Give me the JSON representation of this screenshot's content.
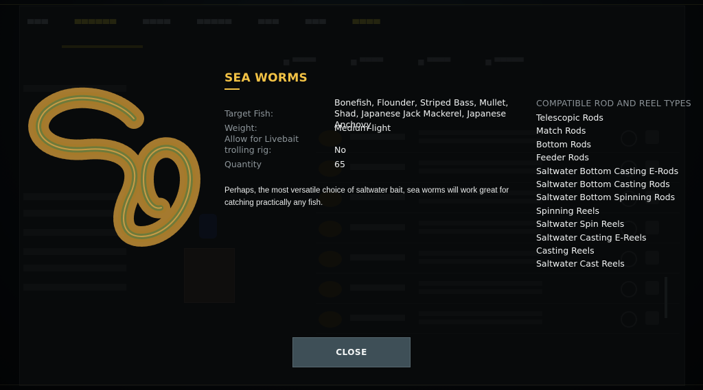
{
  "item": {
    "title": "SEA WORMS",
    "target_fish_label": "Target Fish:",
    "target_fish_value": "Bonefish, Flounder, Striped Bass, Mullet, Shad, Japanese Jack Mackerel, Japanese Anchovy",
    "weight_label": "Weight:",
    "weight_value": "Medium-light",
    "livebait_label_line1": "Allow for Livebait",
    "livebait_label_line2": "trolling rig:",
    "livebait_value": "No",
    "quantity_label": "Quantity",
    "quantity_value": "65",
    "description": "Perhaps, the most versatile choice of saltwater bait, sea worms will work great for catching practically any fish."
  },
  "compatibility": {
    "heading": "COMPATIBLE ROD AND REEL TYPES",
    "items": [
      "Telescopic Rods",
      "Match Rods",
      "Bottom Rods",
      "Feeder Rods",
      "Saltwater Bottom Casting E-Rods",
      "Saltwater Bottom Casting Rods",
      "Saltwater Bottom Spinning Rods",
      "Spinning Reels",
      "Saltwater Spin Reels",
      "Saltwater Casting E-Reels",
      "Casting Reels",
      "Saltwater Cast Reels"
    ]
  },
  "buttons": {
    "close_label": "CLOSE"
  },
  "colors": {
    "accent": "#f2c245",
    "button_bg": "#3e4f57",
    "label": "#8c9499"
  },
  "icons": {
    "worm": "sea-worm-image"
  }
}
